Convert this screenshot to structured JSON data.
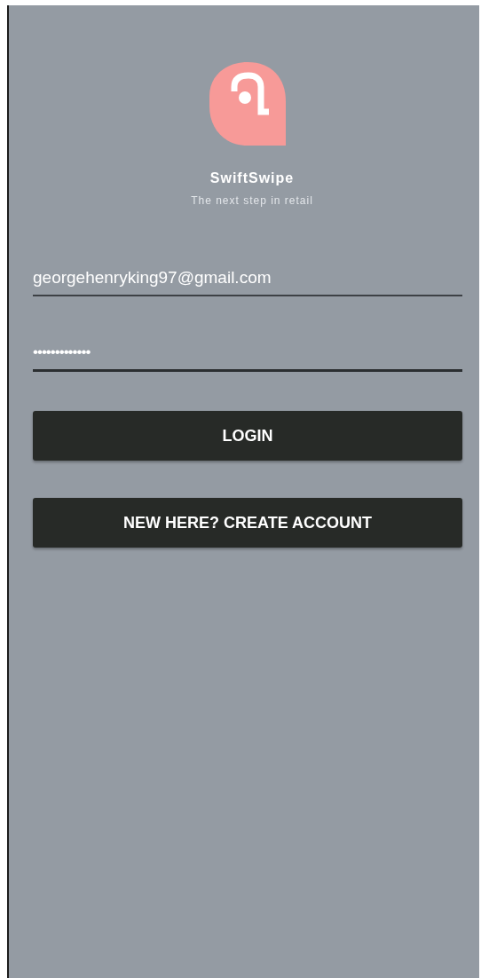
{
  "app": {
    "name": "SwiftSwipe",
    "tagline": "The next step in retail"
  },
  "fields": [
    {
      "kind": "email",
      "value": "georgehenryking97@gmail.com",
      "focused": false
    },
    {
      "kind": "password",
      "value": "•••••••••••••",
      "focused": true
    }
  ],
  "buttons": [
    "LOGIN",
    "NEW HERE? CREATE ACCOUNT"
  ]
}
